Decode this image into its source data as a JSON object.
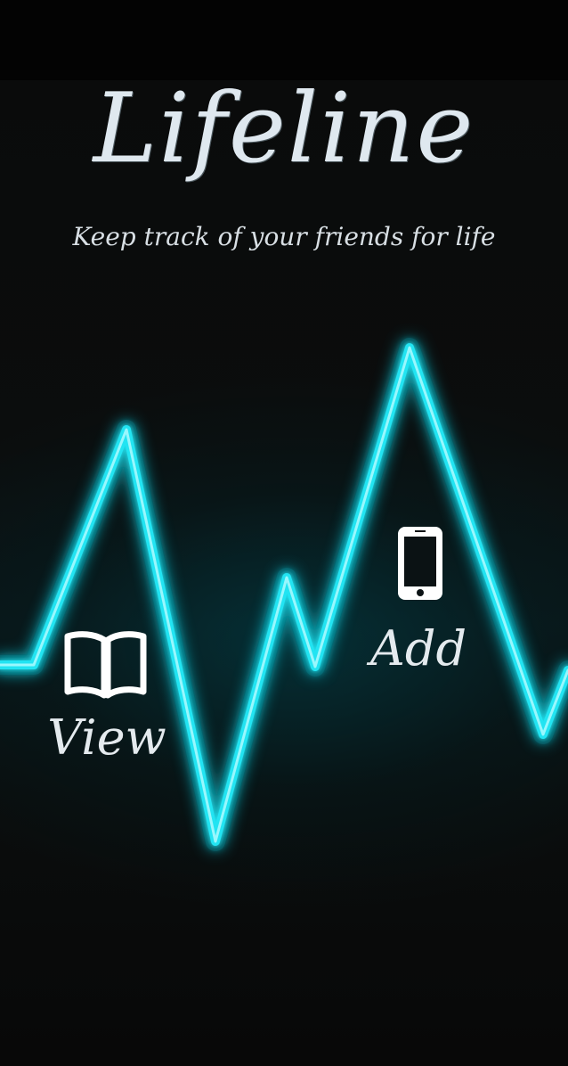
{
  "app": {
    "title": "Lifeline",
    "tagline": "Keep track of your friends for life"
  },
  "actions": {
    "view": {
      "label": "View",
      "icon": "book-icon"
    },
    "add": {
      "label": "Add",
      "icon": "smartphone-icon"
    }
  },
  "colors": {
    "background": "#070707",
    "pulse_line": "#21e6f3",
    "pulse_glow": "#0bbcd0",
    "text": "#dfe8ef"
  }
}
